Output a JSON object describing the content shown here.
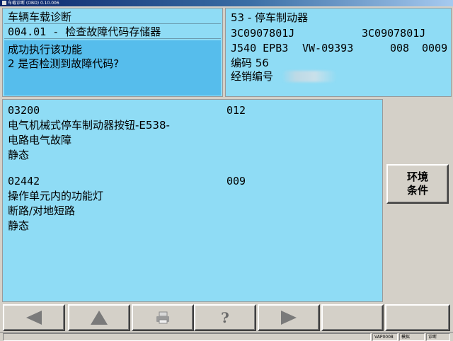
{
  "window": {
    "title": "车载诊断 (OBD)  0.10.006"
  },
  "left_panel": {
    "header": "车辆车载诊断",
    "function": "004.01 - 检查故障代码存储器",
    "status_lines": [
      "成功执行该功能",
      "2 是否检测到故障代码?"
    ]
  },
  "right_panel": {
    "module": "53 - 停车制动器",
    "part_left": "3C0907801J",
    "part_right": "3C0907801J",
    "component": "J540 EPB3",
    "dataset": "VW-09393",
    "version_a": "008",
    "version_b": "0009",
    "coding": "编码 56",
    "dealer_label": "经销编号"
  },
  "faults": [
    {
      "code": "03200",
      "count": "012",
      "lines": [
        "电气机械式停车制动器按钮-E538-",
        "电路电气故障",
        "静态"
      ]
    },
    {
      "code": "02442",
      "count": "009",
      "lines": [
        "操作单元内的功能灯",
        "断路/对地短路",
        "静态"
      ]
    }
  ],
  "side_buttons": {
    "environment": [
      "环境",
      "条件"
    ]
  },
  "nav": {
    "back_icon": "left-triangle",
    "up_icon": "up-triangle",
    "print_icon": "printer",
    "help_icon": "question",
    "forward_icon": "right-triangle",
    "help_label": "?"
  },
  "status_bar": {
    "left": "VAP0008",
    "mid": "模拟",
    "right": "诊断"
  },
  "colors": {
    "panel": "#8fdcf5",
    "status": "#56bdec",
    "chrome": "#d4d0c8",
    "icon": "#7a7a7a"
  }
}
